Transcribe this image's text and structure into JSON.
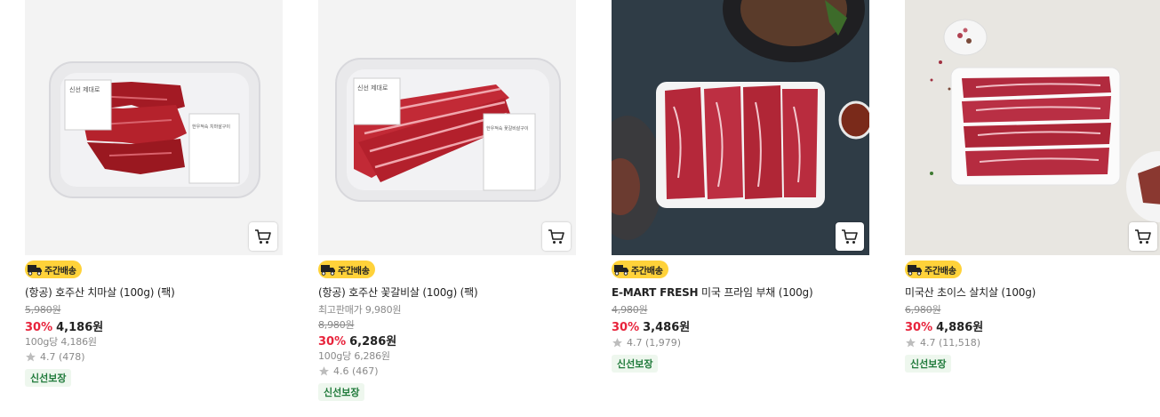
{
  "products": [
    {
      "badge": "주간배송",
      "title": "(항공) 호주산 치마살 (100g) (팩)",
      "original_price": "5,980원",
      "discount": "30%",
      "price": "4,186원",
      "unit_price": "100g당 4,186원",
      "rating": "4.7 (478)",
      "fresh_tag": "신선보장",
      "tray_label_1": "신선 제대로",
      "tray_label_2": "한우적숙 치마살구이"
    },
    {
      "badge": "주간배송",
      "title": "(항공) 호주산 꽃갈비살 (100g) (팩)",
      "best_price": "최고판매가 9,980원",
      "original_price": "8,980원",
      "discount": "30%",
      "price": "6,286원",
      "unit_price": "100g당 6,286원",
      "rating": "4.6 (467)",
      "fresh_tag": "신선보장",
      "tray_label_1": "신선 제대로",
      "tray_label_2": "한우적숙 꽃갈비살구이"
    },
    {
      "badge": "주간배송",
      "title_brand": "E-MART FRESH",
      "title_rest": " 미국 프라임 부채 (100g)",
      "original_price": "4,980원",
      "discount": "30%",
      "price": "3,486원",
      "rating": "4.7 (1,979)",
      "fresh_tag": "신선보장"
    },
    {
      "badge": "주간배송",
      "title": "미국산 초이스 살치살 (100g)",
      "original_price": "6,980원",
      "discount": "30%",
      "price": "4,886원",
      "rating": "4.7 (11,518)",
      "fresh_tag": "신선보장"
    }
  ],
  "colors": {
    "discount": "#e8243c",
    "badge": "#ffd23a",
    "fresh_tag_bg": "#eef7ee",
    "fresh_tag_text": "#1f7a3a",
    "star": "#bdbdbd"
  },
  "icons": {
    "cart": "cart-icon",
    "badge": "truck-icon",
    "rating": "star-icon"
  }
}
